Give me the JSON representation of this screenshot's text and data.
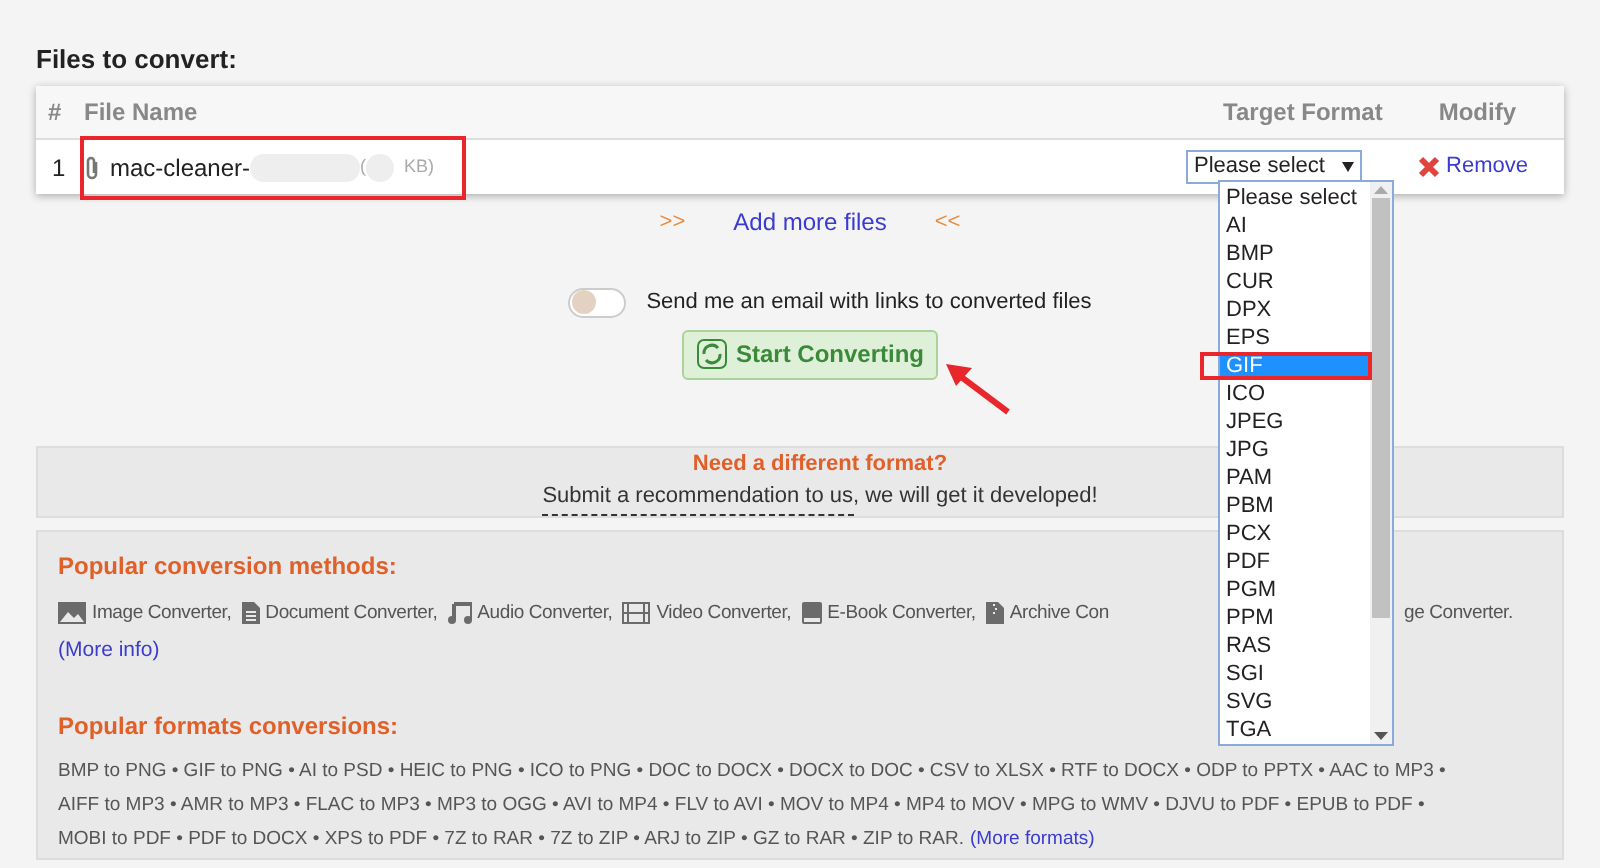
{
  "heading": "Files to convert:",
  "table": {
    "columns": [
      "#",
      "File Name",
      "Target Format",
      "Modify"
    ],
    "rows": [
      {
        "index": "1",
        "file_name": "mac-cleaner-",
        "size_open": "(",
        "size_unit": "KB)",
        "target": "Please select",
        "action": "Remove"
      }
    ]
  },
  "add_more": {
    "left": ">>",
    "label": "Add more files",
    "right": "<<"
  },
  "email_toggle": {
    "on": false,
    "label": "Send me an email with links to converted files"
  },
  "start_button": "Start Converting",
  "dropdown": {
    "options": [
      {
        "label": "Please select",
        "selected": false
      },
      {
        "label": "AI",
        "selected": false
      },
      {
        "label": "BMP",
        "selected": false
      },
      {
        "label": "CUR",
        "selected": false
      },
      {
        "label": "DPX",
        "selected": false
      },
      {
        "label": "EPS",
        "selected": false
      },
      {
        "label": "GIF",
        "selected": true
      },
      {
        "label": "ICO",
        "selected": false
      },
      {
        "label": "JPEG",
        "selected": false
      },
      {
        "label": "JPG",
        "selected": false
      },
      {
        "label": "PAM",
        "selected": false
      },
      {
        "label": "PBM",
        "selected": false
      },
      {
        "label": "PCX",
        "selected": false
      },
      {
        "label": "PDF",
        "selected": false
      },
      {
        "label": "PGM",
        "selected": false
      },
      {
        "label": "PPM",
        "selected": false
      },
      {
        "label": "RAS",
        "selected": false
      },
      {
        "label": "SGI",
        "selected": false
      },
      {
        "label": "SVG",
        "selected": false
      },
      {
        "label": "TGA",
        "selected": false
      }
    ]
  },
  "request": {
    "title": "Need a different format?",
    "link": "Submit a recommendation to us",
    "rest": ", we will get it developed!"
  },
  "methods": {
    "title": "Popular conversion methods:",
    "items": [
      {
        "kind": "image",
        "label": "Image Converter,"
      },
      {
        "kind": "document",
        "label": "Document Converter,"
      },
      {
        "kind": "audio",
        "label": "Audio Converter,"
      },
      {
        "kind": "video",
        "label": "Video Converter,"
      },
      {
        "kind": "ebook",
        "label": "E-Book Converter,"
      },
      {
        "kind": "archive",
        "label": "Archive Con"
      },
      {
        "kind": "fragment",
        "label": "ge Converter."
      }
    ],
    "more": "(More info)"
  },
  "formats": {
    "title": "Popular formats conversions:",
    "lines": [
      "BMP to PNG • GIF to PNG • AI to PSD • HEIC to PNG • ICO to PNG • DOC to DOCX • DOCX to DOC • CSV to XLSX • RTF to DOCX • ODP to PPTX • AAC to MP3 •",
      "AIFF to MP3 • AMR to MP3 • FLAC to MP3 • MP3 to OGG • AVI to MP4 • FLV to AVI • MOV to MP4 • MP4 to MOV • MPG to WMV • DJVU to PDF • EPUB to PDF •",
      "MOBI to PDF • PDF to DOCX • XPS to PDF • 7Z to RAR • 7Z to ZIP • ARJ to ZIP • GZ to RAR • ZIP to RAR."
    ],
    "more": "(More formats)"
  }
}
